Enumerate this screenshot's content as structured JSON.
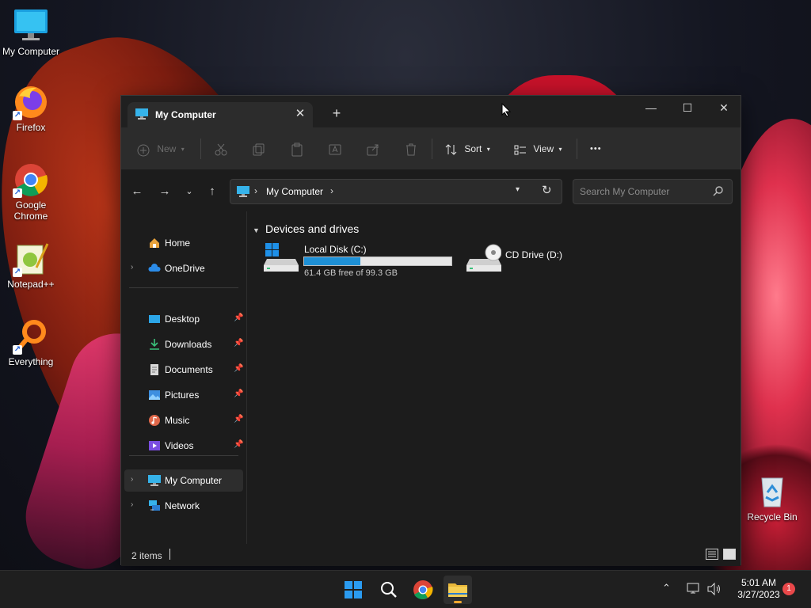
{
  "desktop": {
    "icons": [
      {
        "label": "My Computer"
      },
      {
        "label": "Firefox"
      },
      {
        "label": "Google Chrome"
      },
      {
        "label": "Notepad++"
      },
      {
        "label": "Everything"
      },
      {
        "label": "Recycle Bin"
      }
    ]
  },
  "window": {
    "tab_title": "My Computer",
    "tab_close": "✕",
    "new_tab": "+",
    "minimize": "—",
    "maximize": "☐",
    "close": "✕"
  },
  "toolbar": {
    "new_label": "New",
    "sort_label": "Sort",
    "view_label": "View",
    "more_label": "•••"
  },
  "address": {
    "crumb": "My Computer",
    "search_placeholder": "Search My Computer"
  },
  "sidebar": {
    "items": [
      {
        "label": "Home"
      },
      {
        "label": "OneDrive"
      },
      {
        "label": "Desktop"
      },
      {
        "label": "Downloads"
      },
      {
        "label": "Documents"
      },
      {
        "label": "Pictures"
      },
      {
        "label": "Music"
      },
      {
        "label": "Videos"
      },
      {
        "label": "My Computer"
      },
      {
        "label": "Network"
      }
    ]
  },
  "content": {
    "group_title": "Devices and drives",
    "drives": [
      {
        "name": "Local Disk (C:)",
        "free_text": "61.4 GB free of 99.3 GB",
        "used_fraction": 0.38
      },
      {
        "name": "CD Drive (D:)"
      }
    ]
  },
  "status": {
    "item_count": "2 items"
  },
  "taskbar": {
    "time": "5:01 AM",
    "date": "3/27/2023",
    "notification_count": "1"
  },
  "colors": {
    "accent": "#1e90d6",
    "window_bg": "#1c1c1c",
    "toolbar_bg": "#2c2c2c"
  }
}
